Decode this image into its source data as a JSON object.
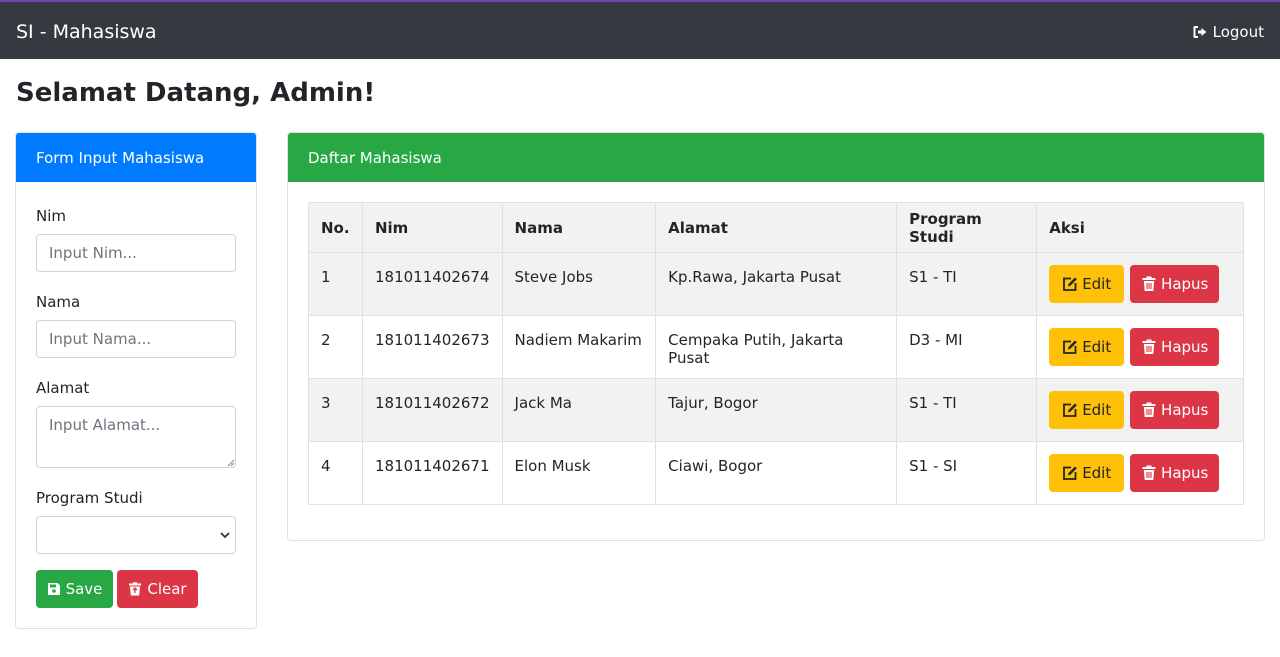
{
  "navbar": {
    "brand": "SI - Mahasiswa",
    "logout_label": "Logout",
    "logout_icon": "sign-out-icon"
  },
  "page": {
    "title": "Selamat Datang, Admin!"
  },
  "form": {
    "header": "Form Input Mahasiswa",
    "nim_label": "Nim",
    "nim_placeholder": "Input Nim...",
    "nama_label": "Nama",
    "nama_placeholder": "Input Nama...",
    "alamat_label": "Alamat",
    "alamat_placeholder": "Input Alamat...",
    "prodi_label": "Program Studi",
    "prodi_value": "",
    "save_label": "Save",
    "clear_label": "Clear"
  },
  "list": {
    "header": "Daftar Mahasiswa",
    "columns": [
      "No.",
      "Nim",
      "Nama",
      "Alamat",
      "Program Studi",
      "Aksi"
    ],
    "edit_label": "Edit",
    "hapus_label": "Hapus",
    "rows": [
      {
        "no": "1",
        "nim": "181011402674",
        "nama": "Steve Jobs",
        "alamat": "Kp.Rawa, Jakarta Pusat",
        "prodi": "S1 - TI"
      },
      {
        "no": "2",
        "nim": "181011402673",
        "nama": "Nadiem Makarim",
        "alamat": "Cempaka Putih, Jakarta Pusat",
        "prodi": "D3 - MI"
      },
      {
        "no": "3",
        "nim": "181011402672",
        "nama": "Jack Ma",
        "alamat": "Tajur, Bogor",
        "prodi": "S1 - TI"
      },
      {
        "no": "4",
        "nim": "181011402671",
        "nama": "Elon Musk",
        "alamat": "Ciawi, Bogor",
        "prodi": "S1 - SI"
      }
    ]
  },
  "colors": {
    "navbar": "#343a40",
    "primary": "#007bff",
    "success": "#28a745",
    "danger": "#dc3545",
    "warning": "#ffc107",
    "accent_line": "#6f42c1"
  }
}
